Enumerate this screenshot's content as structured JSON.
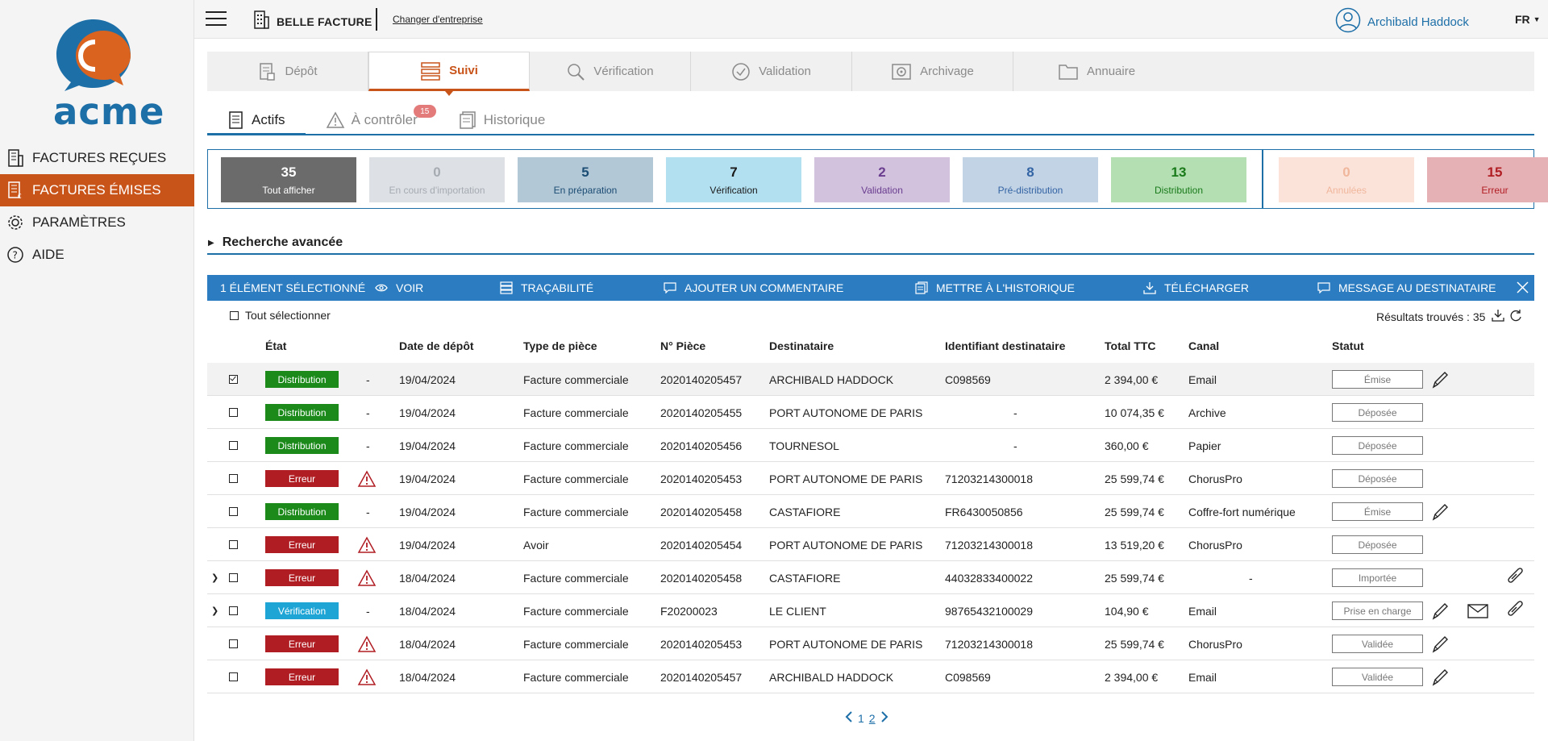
{
  "brand": {
    "logo_text": "acme",
    "logo_blue": "#1d6fa8",
    "logo_orange": "#d9631f"
  },
  "sidebar": {
    "items": [
      {
        "label": "FACTURES REÇUES",
        "icon": "building-invoice-icon",
        "active": false
      },
      {
        "label": "FACTURES ÉMISES",
        "icon": "invoice-euro-icon",
        "active": true
      },
      {
        "label": "PARAMÈTRES",
        "icon": "gear-icon",
        "active": false
      },
      {
        "label": "AIDE",
        "icon": "help-circle-icon",
        "active": false
      }
    ],
    "active_color": "#c9541a"
  },
  "topbar": {
    "company_name": "BELLE FACTURE",
    "change_company": "Changer d'entreprise",
    "user_name": "Archibald Haddock",
    "language": "FR"
  },
  "main_tabs": [
    {
      "label": "Dépôt",
      "icon": "document-upload-icon",
      "active": false
    },
    {
      "label": "Suivi",
      "icon": "list-icon",
      "active": true
    },
    {
      "label": "Vérification",
      "icon": "magnifier-icon",
      "active": false
    },
    {
      "label": "Validation",
      "icon": "check-circle-icon",
      "active": false
    },
    {
      "label": "Archivage",
      "icon": "safe-icon",
      "active": false
    },
    {
      "label": "Annuaire",
      "icon": "folder-icon",
      "active": false
    }
  ],
  "sub_tabs": [
    {
      "label": "Actifs",
      "icon": "document-stack-icon",
      "active": true,
      "badge": ""
    },
    {
      "label": "À contrôler",
      "icon": "warning-icon",
      "active": false,
      "badge": "15"
    },
    {
      "label": "Historique",
      "icon": "history-stack-icon",
      "active": false,
      "badge": ""
    }
  ],
  "counters": [
    {
      "count": "35",
      "label": "Tout afficher",
      "bg": "#6b6b6b",
      "fg": "#ffffff"
    },
    {
      "count": "0",
      "label": "En cours d'importation",
      "bg": "#dde1e6",
      "fg": "#a6abb2"
    },
    {
      "count": "5",
      "label": "En préparation",
      "bg": "#b3c8d6",
      "fg": "#1c4d74"
    },
    {
      "count": "7",
      "label": "Vérification",
      "bg": "#b3e0f0",
      "fg": "#1a1a1a"
    },
    {
      "count": "2",
      "label": "Validation",
      "bg": "#d2c2de",
      "fg": "#6a3d8f"
    },
    {
      "count": "8",
      "label": "Pré-distribution",
      "bg": "#c3d3e6",
      "fg": "#3364a3"
    },
    {
      "count": "13",
      "label": "Distribution",
      "bg": "#b3dfb3",
      "fg": "#1a7a1a"
    },
    {
      "count": "0",
      "label": "Annulées",
      "bg": "#fbe3da",
      "fg": "#f0b79c"
    },
    {
      "count": "15",
      "label": "Erreur",
      "bg": "#e6b1b5",
      "fg": "#b01e24"
    }
  ],
  "advanced_search": "Recherche avancée",
  "action_bar": {
    "selection_label": "1 ÉLÉMENT SÉLECTIONNÉ",
    "actions": [
      {
        "label": "VOIR",
        "icon": "eye-icon"
      },
      {
        "label": "TRAÇABILITÉ",
        "icon": "list-icon"
      },
      {
        "label": "AJOUTER UN COMMENTAIRE",
        "icon": "comment-icon"
      },
      {
        "label": "METTRE À L'HISTORIQUE",
        "icon": "history-stack-icon"
      },
      {
        "label": "TÉLÉCHARGER",
        "icon": "download-icon"
      },
      {
        "label": "MESSAGE AU DESTINATAIRE",
        "icon": "message-icon"
      }
    ],
    "bg": "#2b7cc0"
  },
  "select_all": "Tout sélectionner",
  "results": "Résultats trouvés : 35",
  "table": {
    "columns": [
      "État",
      "Date de dépôt",
      "Type de pièce",
      "N° Pièce",
      "Destinataire",
      "Identifiant destinataire",
      "Total TTC",
      "Canal",
      "Statut"
    ],
    "rows": [
      {
        "expand": false,
        "checked": true,
        "etat": "Distribution",
        "etat_color": "#1b8a1b",
        "warn": false,
        "warn_text": "-",
        "date": "19/04/2024",
        "type": "Facture commerciale",
        "piece": "2020140205457",
        "dest": "ARCHIBALD HADDOCK",
        "ident": "C098569",
        "total": "2 394,00 €",
        "canal": "Email",
        "statut": "Émise",
        "edit": true,
        "mail": false,
        "attach": false
      },
      {
        "expand": false,
        "checked": false,
        "etat": "Distribution",
        "etat_color": "#1b8a1b",
        "warn": false,
        "warn_text": "-",
        "date": "19/04/2024",
        "type": "Facture commerciale",
        "piece": "2020140205455",
        "dest": "PORT AUTONOME DE PARIS",
        "ident": "-",
        "total": "10 074,35 €",
        "canal": "Archive",
        "statut": "Déposée",
        "edit": false,
        "mail": false,
        "attach": false
      },
      {
        "expand": false,
        "checked": false,
        "etat": "Distribution",
        "etat_color": "#1b8a1b",
        "warn": false,
        "warn_text": "-",
        "date": "19/04/2024",
        "type": "Facture commerciale",
        "piece": "2020140205456",
        "dest": "TOURNESOL",
        "ident": "-",
        "total": "360,00 €",
        "canal": "Papier",
        "statut": "Déposée",
        "edit": false,
        "mail": false,
        "attach": false
      },
      {
        "expand": false,
        "checked": false,
        "etat": "Erreur",
        "etat_color": "#b01e24",
        "warn": true,
        "warn_text": "",
        "date": "19/04/2024",
        "type": "Facture commerciale",
        "piece": "2020140205453",
        "dest": "PORT AUTONOME DE PARIS",
        "ident": "71203214300018",
        "total": "25 599,74 €",
        "canal": "ChorusPro",
        "statut": "Déposée",
        "edit": false,
        "mail": false,
        "attach": false
      },
      {
        "expand": false,
        "checked": false,
        "etat": "Distribution",
        "etat_color": "#1b8a1b",
        "warn": false,
        "warn_text": "-",
        "date": "19/04/2024",
        "type": "Facture commerciale",
        "piece": "2020140205458",
        "dest": "CASTAFIORE",
        "ident": "FR6430050856",
        "total": "25 599,74 €",
        "canal": "Coffre-fort numérique",
        "statut": "Émise",
        "edit": true,
        "mail": false,
        "attach": false
      },
      {
        "expand": false,
        "checked": false,
        "etat": "Erreur",
        "etat_color": "#b01e24",
        "warn": true,
        "warn_text": "",
        "date": "19/04/2024",
        "type": "Avoir",
        "piece": "2020140205454",
        "dest": "PORT AUTONOME DE PARIS",
        "ident": "71203214300018",
        "total": "13 519,20 €",
        "canal": "ChorusPro",
        "statut": "Déposée",
        "edit": false,
        "mail": false,
        "attach": false
      },
      {
        "expand": true,
        "checked": false,
        "etat": "Erreur",
        "etat_color": "#b01e24",
        "warn": true,
        "warn_text": "",
        "date": "18/04/2024",
        "type": "Facture commerciale",
        "piece": "2020140205458",
        "dest": "CASTAFIORE",
        "ident": "44032833400022",
        "total": "25 599,74 €",
        "canal": "-",
        "statut": "Importée",
        "edit": false,
        "mail": false,
        "attach": true
      },
      {
        "expand": true,
        "checked": false,
        "etat": "Vérification",
        "etat_color": "#1ea5d6",
        "warn": false,
        "warn_text": "-",
        "date": "18/04/2024",
        "type": "Facture commerciale",
        "piece": "F20200023",
        "dest": "LE CLIENT",
        "ident": "98765432100029",
        "total": "104,90 €",
        "canal": "Email",
        "statut": "Prise en charge",
        "edit": true,
        "mail": true,
        "attach": true
      },
      {
        "expand": false,
        "checked": false,
        "etat": "Erreur",
        "etat_color": "#b01e24",
        "warn": true,
        "warn_text": "",
        "date": "18/04/2024",
        "type": "Facture commerciale",
        "piece": "2020140205453",
        "dest": "PORT AUTONOME DE PARIS",
        "ident": "71203214300018",
        "total": "25 599,74 €",
        "canal": "ChorusPro",
        "statut": "Validée",
        "edit": true,
        "mail": false,
        "attach": false
      },
      {
        "expand": false,
        "checked": false,
        "etat": "Erreur",
        "etat_color": "#b01e24",
        "warn": true,
        "warn_text": "",
        "date": "18/04/2024",
        "type": "Facture commerciale",
        "piece": "2020140205457",
        "dest": "ARCHIBALD HADDOCK",
        "ident": "C098569",
        "total": "2 394,00 €",
        "canal": "Email",
        "statut": "Validée",
        "edit": true,
        "mail": false,
        "attach": false
      }
    ]
  },
  "pagination": {
    "pages": [
      "1",
      "2"
    ],
    "current": "1"
  }
}
